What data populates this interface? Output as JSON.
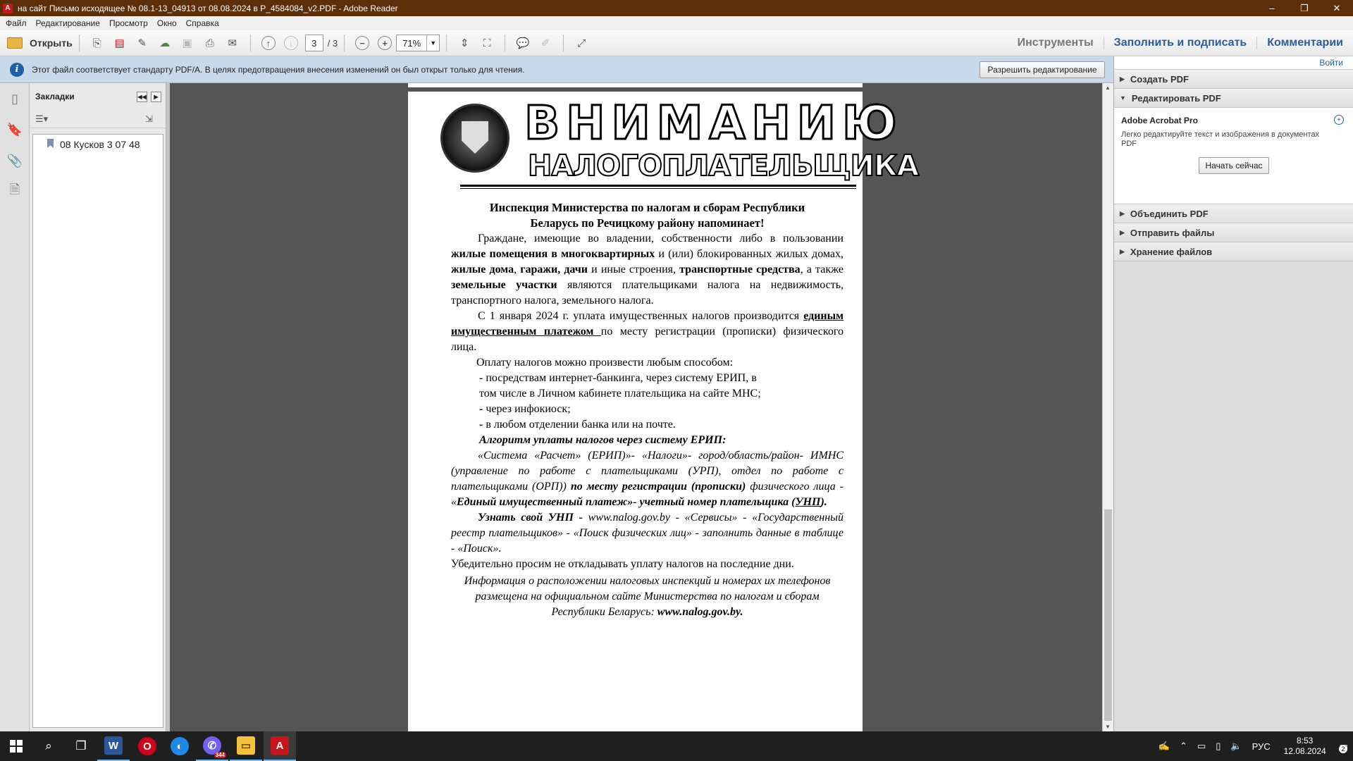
{
  "window": {
    "title": "на сайт Письмо исходящее № 08.1-13_04913 от 08.08.2024 в P_4584084_v2.PDF - Adobe Reader",
    "controls": [
      "–",
      "❐",
      "✕"
    ]
  },
  "menu": [
    "Файл",
    "Редактирование",
    "Просмотр",
    "Окно",
    "Справка"
  ],
  "toolbar": {
    "open_label": "Открыть",
    "page_current": "3",
    "page_total": "/ 3",
    "zoom": "71%",
    "tools_label": "Инструменты",
    "fill_sign_label": "Заполнить и подписать",
    "comments_label": "Комментарии"
  },
  "infobar": {
    "message": "Этот файл соответствует стандарту PDF/A. В целях предотвращения внесения изменений он был открыт только для чтения.",
    "button": "Разрешить редактирование"
  },
  "bookmarks": {
    "title": "Закладки",
    "items": [
      "08 Кусков 3 07 48"
    ]
  },
  "right_panel": {
    "signin": "Войти",
    "sections": {
      "create_pdf": "Создать PDF",
      "edit_pdf": "Редактировать PDF",
      "combine_pdf": "Объединить PDF",
      "send_files": "Отправить файлы",
      "store_files": "Хранение файлов"
    },
    "acrobat": {
      "title": "Adobe Acrobat Pro",
      "desc": "Легко редактируйте текст и изображения в документах PDF",
      "button": "Начать сейчас"
    }
  },
  "document": {
    "banner_main": "ВНИМАНИЮ",
    "banner_sub": "НАЛОГОПЛАТЕЛЬЩИКА",
    "heading_1": "Инспекция Министерства по налогам и сборам Республики",
    "heading_2": "Беларусь по Речицкому району напоминает!",
    "p1": {
      "a": "Граждане, имеющие во владении, собственности либо в пользовании ",
      "b": "жилые помещения в многоквартирных",
      "c": " и (или) блокированных жилых домах, ",
      "d": "жилые дома",
      "e": ", ",
      "f": "гаражи, дачи",
      "g": " и иные строения, ",
      "h": "транспортные средства",
      "i": ", а также ",
      "j": "земельные участки",
      "k": " являются плательщиками налога на недвижимость, транспортного налога, земельного налога."
    },
    "p2": {
      "a": "С 1 января 2024 г. уплата имущественных налогов производится ",
      "b": "единым имущественным платежом ",
      "c": " по месту регистрации (прописки) физического лица."
    },
    "p3": "Оплату налогов можно произвести любым способом:",
    "bullets": {
      "b1a": "- ",
      "b1b": "посредствам интернет-банкинга, через систему ЕРИП, в",
      "b1c": "том числе в Личном кабинете плательщика на сайте МНС;",
      "b2a": "- ",
      "b2b": "через инфокиоск;",
      "b3a": "- ",
      "b3b": "в любом отделении банка или на почте."
    },
    "algo_title": "Алгоритм уплаты налогов через систему ЕРИП:",
    "algo": {
      "a": "«Система «Расчет» (ЕРИП)»- «Налоги»- город/область/район- ИМНС (управление по работе с плательщиками (УРП), отдел по работе с плательщиками (ОРП)) ",
      "b": "по месту регистрации (прописки)",
      "c": " физического лица - «",
      "d": "Единый имущественный платеж",
      "e": "»- учетный номер плательщика (",
      "f": "УНП",
      "g": ")."
    },
    "unp": {
      "a": "Узнать свой УНП -",
      "b": " www.nalog.gov.by - «Сервисы» - «Государственный реестр плательщиков» - «Поиск физических лиц» - заполнить данные   в таблице - «Поиск»."
    },
    "urge": "Убедительно просим не откладывать уплату налогов на последние дни.",
    "info": {
      "a": "Информация о расположении налоговых инспекций и номерах их телефонов размещена на официальном сайте Министерства по налогам и сборам Республики Беларусь: ",
      "b": "www.nalog.gov.by."
    }
  },
  "taskbar": {
    "viber_badge": "344",
    "tray_lang": "РУС",
    "time": "8:53",
    "date": "12.08.2024",
    "notifications": "2"
  }
}
